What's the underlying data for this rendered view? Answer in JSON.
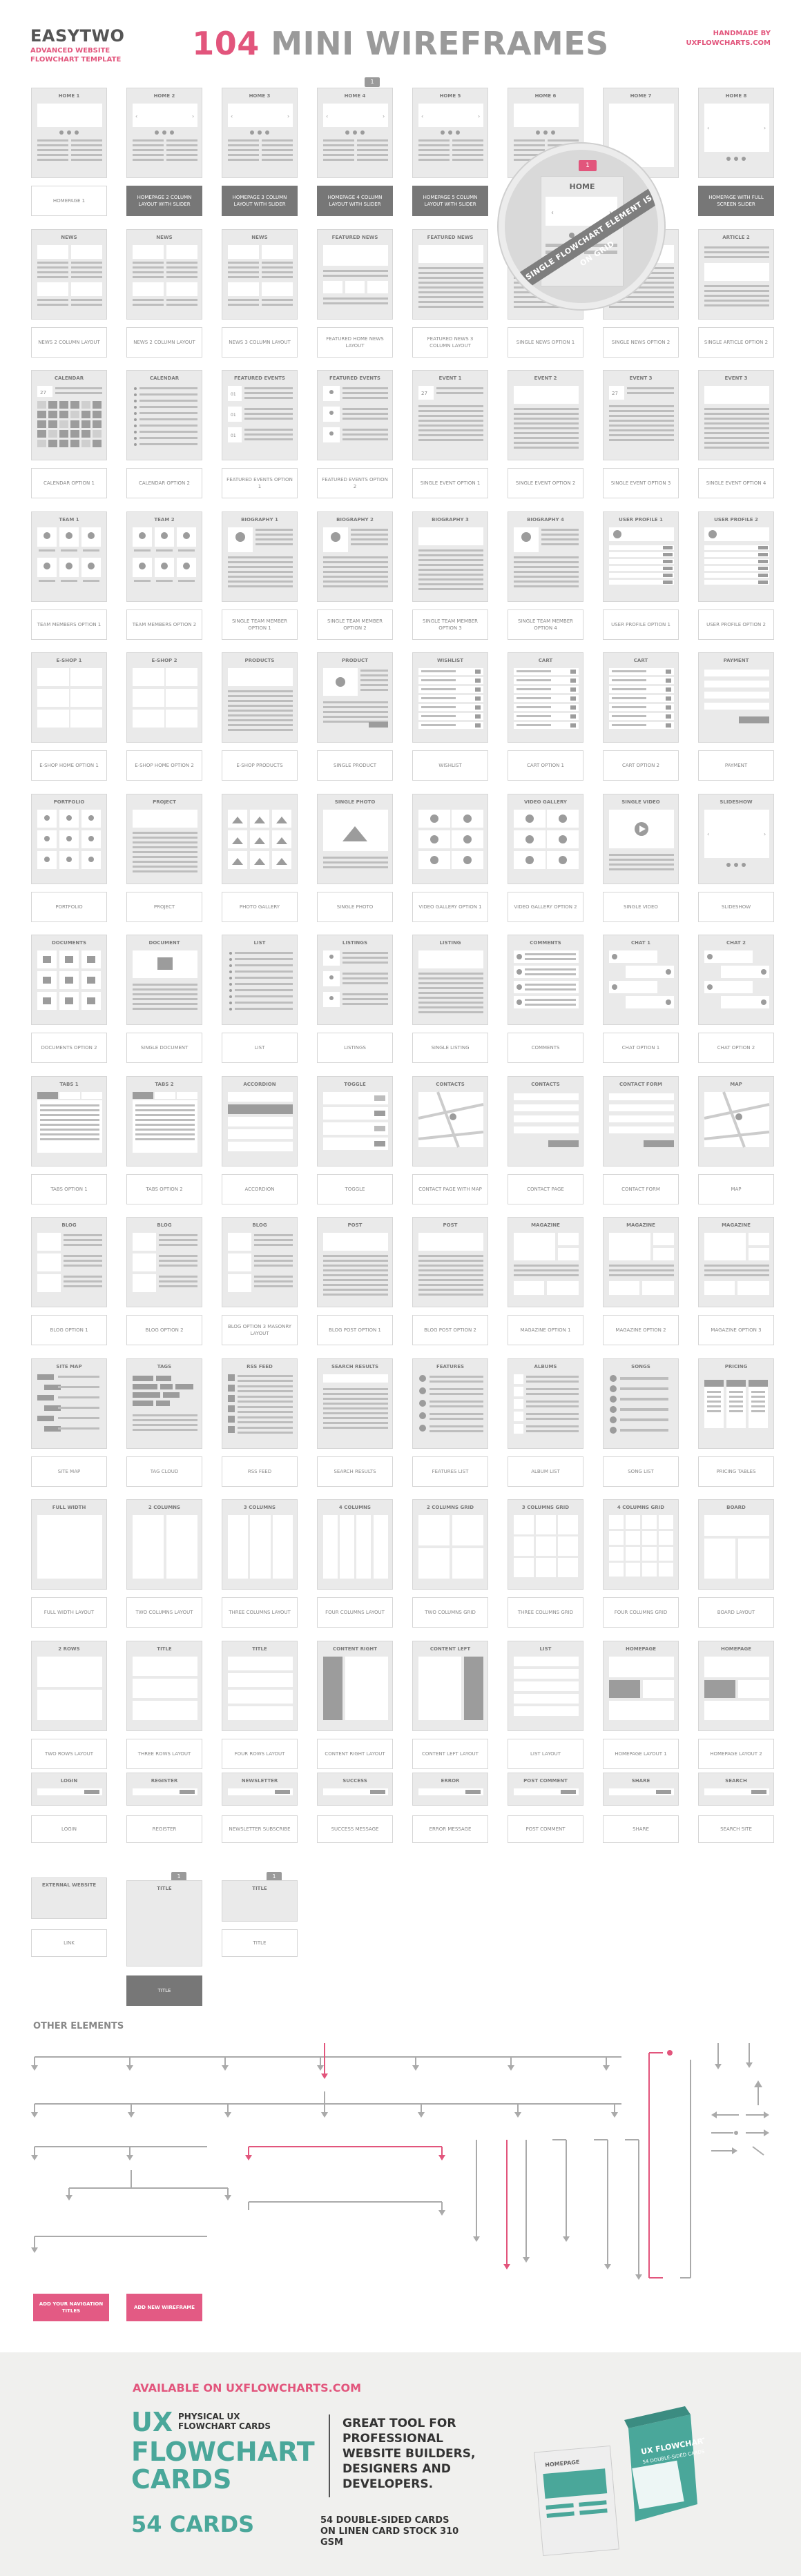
{
  "header": {
    "brand": "EASYTWO",
    "brand_sub": "ADVANCED WEBSITE FLOWCHART TEMPLATE",
    "title_num": "104",
    "title_rest": "MINI WIREFRAMES",
    "handmade": "HANDMADE BY",
    "site": "UXFLOWCHARTS.COM",
    "badge": "1"
  },
  "magnifier": {
    "badge": "1",
    "label": "HOME",
    "band": "EVERY SINGLE FLOWCHART ELEMENT IS BUILT ON GRID"
  },
  "rows": [
    {
      "cards": [
        {
          "t": "HOME 1",
          "d": "HOMEPAGE 1",
          "v": "hero"
        },
        {
          "t": "HOME 2",
          "d": "HOMEPAGE 2 COLUMN LAYOUT WITH SLIDER",
          "v": "hero2",
          "dark": true
        },
        {
          "t": "HOME 3",
          "d": "HOMEPAGE 3 COLUMN LAYOUT WITH SLIDER",
          "v": "hero2",
          "dark": true
        },
        {
          "t": "HOME 4",
          "d": "HOMEPAGE 4 COLUMN LAYOUT WITH SLIDER",
          "v": "hero2",
          "dark": true
        },
        {
          "t": "HOME 5",
          "d": "HOMEPAGE 5 COLUMN LAYOUT WITH SLIDER",
          "v": "hero2",
          "dark": true
        },
        {
          "t": "HOME 6",
          "d": "",
          "v": "hero"
        },
        {
          "t": "HOME 7",
          "d": "",
          "v": "blank"
        },
        {
          "t": "HOME 8",
          "d": "HOMEPAGE WITH FULL SCREEN SLIDER",
          "v": "slider",
          "dark": true
        }
      ]
    },
    {
      "cards": [
        {
          "t": "NEWS",
          "d": "NEWS 2 COLUMN LAYOUT",
          "v": "news"
        },
        {
          "t": "NEWS",
          "d": "NEWS 2 COLUMN LAYOUT",
          "v": "news"
        },
        {
          "t": "NEWS",
          "d": "NEWS 3 COLUMN LAYOUT",
          "v": "news"
        },
        {
          "t": "FEATURED NEWS",
          "d": "FEATURED HOME NEWS LAYOUT",
          "v": "featured"
        },
        {
          "t": "FEATURED NEWS",
          "d": "FEATURED NEWS 3 COLUMN LAYOUT",
          "v": "lines"
        },
        {
          "t": "",
          "d": "SINGLE NEWS OPTION 1",
          "v": "lines"
        },
        {
          "t": "",
          "d": "SINGLE NEWS OPTION 2",
          "v": "lines"
        },
        {
          "t": "ARTICLE 2",
          "d": "SINGLE ARTICLE OPTION 2",
          "v": "article"
        }
      ]
    },
    {
      "cards": [
        {
          "t": "CALENDAR",
          "d": "CALENDAR OPTION 1",
          "v": "calendar"
        },
        {
          "t": "CALENDAR",
          "d": "CALENDAR OPTION 2",
          "v": "list"
        },
        {
          "t": "FEATURED EVENTS",
          "d": "FEATURED EVENTS OPTION 1",
          "v": "events"
        },
        {
          "t": "FEATURED EVENTS",
          "d": "FEATURED EVENTS OPTION 2",
          "v": "pins"
        },
        {
          "t": "EVENT 1",
          "d": "SINGLE EVENT OPTION 1",
          "v": "event"
        },
        {
          "t": "EVENT 2",
          "d": "SINGLE EVENT OPTION 2",
          "v": "lines"
        },
        {
          "t": "EVENT 3",
          "d": "SINGLE EVENT OPTION 3",
          "v": "event"
        },
        {
          "t": "EVENT 3",
          "d": "SINGLE EVENT OPTION 4",
          "v": "lines"
        }
      ]
    },
    {
      "cards": [
        {
          "t": "TEAM 1",
          "d": "TEAM MEMBERS OPTION 1",
          "v": "team"
        },
        {
          "t": "TEAM 2",
          "d": "TEAM MEMBERS OPTION 2",
          "v": "team"
        },
        {
          "t": "BIOGRAPHY 1",
          "d": "SINGLE TEAM MEMBER OPTION 1",
          "v": "bio"
        },
        {
          "t": "BIOGRAPHY 2",
          "d": "SINGLE TEAM MEMBER OPTION 2",
          "v": "bio"
        },
        {
          "t": "BIOGRAPHY 3",
          "d": "SINGLE TEAM MEMBER OPTION 3",
          "v": "lines"
        },
        {
          "t": "BIOGRAPHY 4",
          "d": "SINGLE TEAM MEMBER OPTION 4",
          "v": "bio"
        },
        {
          "t": "USER PROFILE 1",
          "d": "USER PROFILE OPTION 1",
          "v": "profile"
        },
        {
          "t": "USER PROFILE 2",
          "d": "USER PROFILE OPTION 2",
          "v": "profile"
        }
      ]
    },
    {
      "cards": [
        {
          "t": "E-SHOP 1",
          "d": "E-SHOP HOME OPTION 1",
          "v": "grid6"
        },
        {
          "t": "E-SHOP 2",
          "d": "E-SHOP HOME OPTION 2",
          "v": "grid6"
        },
        {
          "t": "PRODUCTS",
          "d": "E-SHOP PRODUCTS",
          "v": "lines"
        },
        {
          "t": "PRODUCT",
          "d": "SINGLE PRODUCT",
          "v": "product"
        },
        {
          "t": "WISHLIST",
          "d": "WISHLIST",
          "v": "rows"
        },
        {
          "t": "CART",
          "d": "CART OPTION 1",
          "v": "rows"
        },
        {
          "t": "CART",
          "d": "CART OPTION 2",
          "v": "rows"
        },
        {
          "t": "PAYMENT",
          "d": "PAYMENT",
          "v": "form"
        }
      ]
    },
    {
      "cards": [
        {
          "t": "PORTFOLIO",
          "d": "PORTFOLIO",
          "v": "portfolio"
        },
        {
          "t": "PROJECT",
          "d": "PROJECT",
          "v": "lines"
        },
        {
          "t": "",
          "d": "PHOTO GALLERY",
          "v": "gallery"
        },
        {
          "t": "SINGLE PHOTO",
          "d": "SINGLE PHOTO",
          "v": "photo"
        },
        {
          "t": "",
          "d": "VIDEO GALLERY OPTION 1",
          "v": "videos"
        },
        {
          "t": "VIDEO GALLERY",
          "d": "VIDEO GALLERY OPTION 2",
          "v": "videos"
        },
        {
          "t": "SINGLE VIDEO",
          "d": "SINGLE VIDEO",
          "v": "video"
        },
        {
          "t": "SLIDESHOW",
          "d": "SLIDESHOW",
          "v": "slider"
        }
      ]
    },
    {
      "cards": [
        {
          "t": "DOCUMENTS",
          "d": "DOCUMENTS OPTION 2",
          "v": "docs"
        },
        {
          "t": "DOCUMENT",
          "d": "SINGLE DOCUMENT",
          "v": "doc"
        },
        {
          "t": "LIST",
          "d": "LIST",
          "v": "list"
        },
        {
          "t": "LISTINGS",
          "d": "LISTINGS",
          "v": "pins"
        },
        {
          "t": "LISTING",
          "d": "SINGLE LISTING",
          "v": "lines"
        },
        {
          "t": "COMMENTS",
          "d": "COMMENTS",
          "v": "comments"
        },
        {
          "t": "CHAT 1",
          "d": "CHAT OPTION 1",
          "v": "chat"
        },
        {
          "t": "CHAT 2",
          "d": "CHAT OPTION 2",
          "v": "chat"
        }
      ]
    },
    {
      "cards": [
        {
          "t": "TABS 1",
          "d": "TABS OPTION 1",
          "v": "tabs"
        },
        {
          "t": "TABS 2",
          "d": "TABS OPTION 2",
          "v": "tabs"
        },
        {
          "t": "ACCORDION",
          "d": "ACCORDION",
          "v": "accordion"
        },
        {
          "t": "TOGGLE",
          "d": "TOGGLE",
          "v": "toggle"
        },
        {
          "t": "CONTACTS",
          "d": "CONTACT PAGE WITH MAP",
          "v": "map"
        },
        {
          "t": "CONTACTS",
          "d": "CONTACT PAGE",
          "v": "form"
        },
        {
          "t": "CONTACT FORM",
          "d": "CONTACT FORM",
          "v": "form"
        },
        {
          "t": "MAP",
          "d": "MAP",
          "v": "map"
        }
      ]
    },
    {
      "cards": [
        {
          "t": "BLOG",
          "d": "BLOG OPTION 1",
          "v": "blog"
        },
        {
          "t": "BLOG",
          "d": "BLOG OPTION 2",
          "v": "blog"
        },
        {
          "t": "BLOG",
          "d": "BLOG OPTION 3 MASONRY LAYOUT",
          "v": "blog"
        },
        {
          "t": "POST",
          "d": "BLOG POST OPTION 1",
          "v": "lines"
        },
        {
          "t": "POST",
          "d": "BLOG POST OPTION 2",
          "v": "lines"
        },
        {
          "t": "MAGAZINE",
          "d": "MAGAZINE OPTION 1",
          "v": "magazine"
        },
        {
          "t": "MAGAZINE",
          "d": "MAGAZINE OPTION 2",
          "v": "magazine"
        },
        {
          "t": "MAGAZINE",
          "d": "MAGAZINE OPTION 3",
          "v": "magazine"
        }
      ]
    },
    {
      "cards": [
        {
          "t": "SITE MAP",
          "d": "SITE MAP",
          "v": "sitemap"
        },
        {
          "t": "TAGS",
          "d": "TAG CLOUD",
          "v": "tags"
        },
        {
          "t": "RSS FEED",
          "d": "RSS FEED",
          "v": "rss"
        },
        {
          "t": "SEARCH RESULTS",
          "d": "SEARCH RESULTS",
          "v": "search"
        },
        {
          "t": "FEATURES",
          "d": "FEATURES LIST",
          "v": "features"
        },
        {
          "t": "ALBUMS",
          "d": "ALBUM LIST",
          "v": "albums"
        },
        {
          "t": "SONGS",
          "d": "SONG LIST",
          "v": "songs"
        },
        {
          "t": "PRICING",
          "d": "PRICING TABLES",
          "v": "pricing"
        }
      ]
    },
    {
      "cards": [
        {
          "t": "FULL WIDTH",
          "d": "FULL WIDTH LAYOUT",
          "v": "blank"
        },
        {
          "t": "2 COLUMNS",
          "d": "TWO COLUMNS LAYOUT",
          "v": "col2"
        },
        {
          "t": "3 COLUMNS",
          "d": "THREE COLUMNS LAYOUT",
          "v": "col3"
        },
        {
          "t": "4 COLUMNS",
          "d": "FOUR COLUMNS LAYOUT",
          "v": "col4"
        },
        {
          "t": "2 COLUMNS GRID",
          "d": "TWO COLUMNS GRID",
          "v": "grid2"
        },
        {
          "t": "3 COLUMNS GRID",
          "d": "THREE COLUMNS GRID",
          "v": "grid3"
        },
        {
          "t": "4 COLUMNS GRID",
          "d": "FOUR COLUMNS GRID",
          "v": "grid4"
        },
        {
          "t": "BOARD",
          "d": "BOARD LAYOUT",
          "v": "board"
        }
      ]
    },
    {
      "cards": [
        {
          "t": "2 ROWS",
          "d": "TWO ROWS LAYOUT",
          "v": "rows2"
        },
        {
          "t": "TITLE",
          "d": "THREE ROWS LAYOUT",
          "v": "rows3"
        },
        {
          "t": "TITLE",
          "d": "FOUR ROWS LAYOUT",
          "v": "rows4"
        },
        {
          "t": "CONTENT RIGHT",
          "d": "CONTENT RIGHT LAYOUT",
          "v": "cright"
        },
        {
          "t": "CONTENT LEFT",
          "d": "CONTENT LEFT LAYOUT",
          "v": "cleft"
        },
        {
          "t": "LIST",
          "d": "LIST LAYOUT",
          "v": "listlayout"
        },
        {
          "t": "HOMEPAGE",
          "d": "HOMEPAGE LAYOUT 1",
          "v": "hp"
        },
        {
          "t": "HOMEPAGE",
          "d": "HOMEPAGE LAYOUT 2",
          "v": "hp"
        }
      ]
    }
  ],
  "small": [
    {
      "t": "LOGIN",
      "d": "LOGIN"
    },
    {
      "t": "REGISTER",
      "d": "REGISTER"
    },
    {
      "t": "NEWSLETTER",
      "d": "NEWSLETTER SUBSCRIBE"
    },
    {
      "t": "SUCCESS",
      "d": "SUCCESS MESSAGE"
    },
    {
      "t": "ERROR",
      "d": "ERROR MESSAGE"
    },
    {
      "t": "POST COMMENT",
      "d": "POST COMMENT"
    },
    {
      "t": "SHARE",
      "d": "SHARE"
    },
    {
      "t": "SEARCH",
      "d": "SEARCH SITE"
    }
  ],
  "last": [
    {
      "t": "EXTERNAL WEBSITE",
      "d": "LINK"
    },
    {
      "t": "TITLE",
      "d": "",
      "badge": "1"
    },
    {
      "t": "TITLE",
      "d": "TITLE",
      "badge": "1"
    }
  ],
  "other": {
    "title": "OTHER ELEMENTS",
    "btn1": "ADD YOUR NAVIGATION TITLES",
    "btn2": "ADD NEW WIREFRAME"
  },
  "colors": {
    "accent": "#e2557c",
    "teal": "#4aa79a",
    "card": "#eaeaea",
    "block": "#bdbdbd"
  },
  "banner": {
    "available": "AVAILABLE ON",
    "site": "UXFLOWCHARTS.COM",
    "ux": "UX",
    "physical": "PHYSICAL UX FLOWCHART CARDS",
    "flowchart": "FLOWCHART",
    "cards_word": "CARDS",
    "great": "GREAT TOOL FOR PROFESSIONAL WEBSITE BUILDERS, DESIGNERS AND DEVELOPERS.",
    "count": "54 CARDS",
    "stock": "54 DOUBLE-SIDED CARDS ON LINEN CARD STOCK 310 GSM",
    "box_top": "UX FLOWCHARTS",
    "box_sub": "54 DOUBLE-SIDED CARDS",
    "box_card": "HOMEPAGE"
  }
}
